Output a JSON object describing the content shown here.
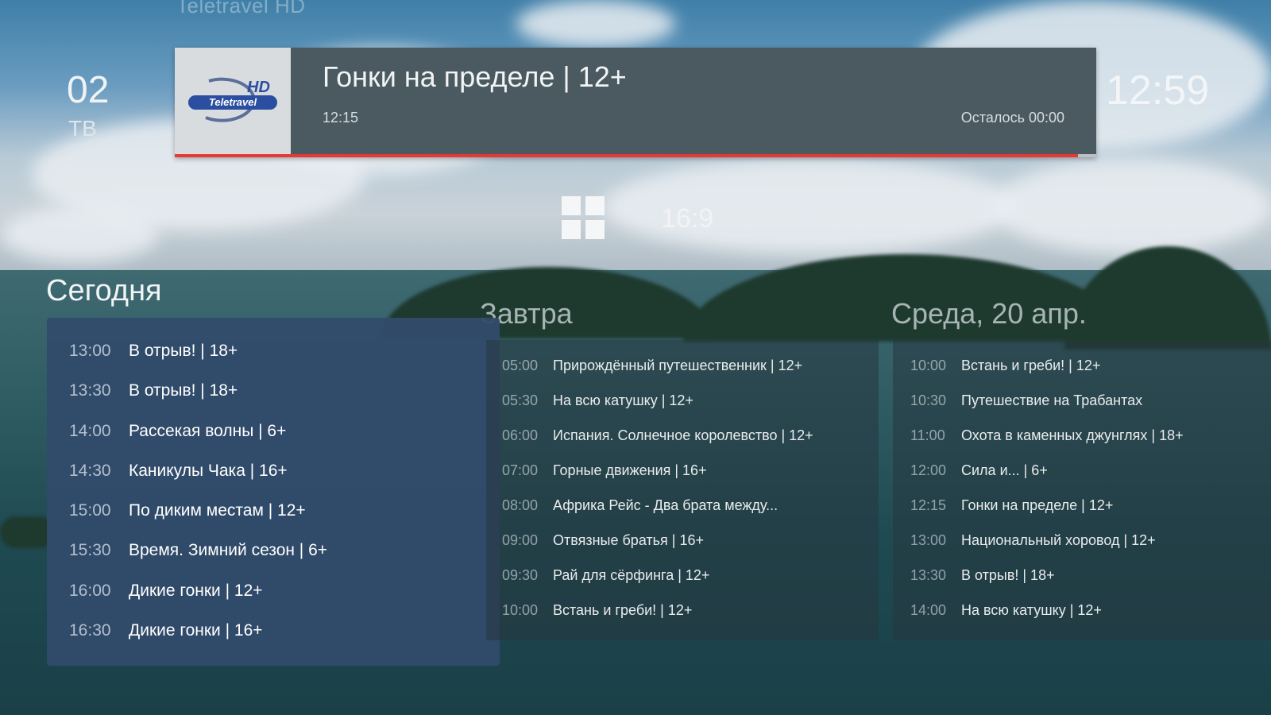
{
  "channel": {
    "faded_name": "Teletravel HD",
    "number": "02",
    "kind": "ТВ",
    "logo_text": "Teletravel",
    "logo_badge": "HD"
  },
  "clock": "12:59",
  "now_playing": {
    "title": "Гонки на пределе | 12+",
    "start": "12:15",
    "remaining": "Осталось 00:00",
    "progress": 0.98,
    "progress_color": "#e53935"
  },
  "controls": {
    "grid_icon": "grid-icon",
    "aspect": "16:9"
  },
  "schedule": {
    "today": {
      "title": "Сегодня",
      "items": [
        {
          "time": "13:00",
          "program": "В отрыв! | 18+"
        },
        {
          "time": "13:30",
          "program": "В отрыв! | 18+"
        },
        {
          "time": "14:00",
          "program": "Рассекая волны | 6+"
        },
        {
          "time": "14:30",
          "program": "Каникулы Чака | 16+"
        },
        {
          "time": "15:00",
          "program": "По диким местам | 12+"
        },
        {
          "time": "15:30",
          "program": "Время. Зимний сезон | 6+"
        },
        {
          "time": "16:00",
          "program": "Дикие гонки | 12+"
        },
        {
          "time": "16:30",
          "program": "Дикие гонки | 16+"
        }
      ]
    },
    "tomorrow": {
      "title": "Завтра",
      "items": [
        {
          "time": "05:00",
          "program": "Прирождённый путешественник | 12+"
        },
        {
          "time": "05:30",
          "program": "На всю катушку | 12+"
        },
        {
          "time": "06:00",
          "program": "Испания. Солнечное королевство | 12+"
        },
        {
          "time": "07:00",
          "program": "Горные движения | 16+"
        },
        {
          "time": "08:00",
          "program": "Африка Рейс - Два брата между..."
        },
        {
          "time": "09:00",
          "program": "Отвязные братья | 16+"
        },
        {
          "time": "09:30",
          "program": "Рай для сёрфинга | 12+"
        },
        {
          "time": "10:00",
          "program": "Встань и греби! | 12+"
        }
      ]
    },
    "wednesday": {
      "title": "Среда, 20 апр.",
      "items": [
        {
          "time": "10:00",
          "program": "Встань и греби! | 12+"
        },
        {
          "time": "10:30",
          "program": "Путешествие на Трабантах"
        },
        {
          "time": "11:00",
          "program": "Охота в каменных джунглях | 18+"
        },
        {
          "time": "12:00",
          "program": "Сила и... | 6+"
        },
        {
          "time": "12:15",
          "program": "Гонки на пределе | 12+"
        },
        {
          "time": "13:00",
          "program": "Национальный хоровод | 12+"
        },
        {
          "time": "13:30",
          "program": "В отрыв! | 18+"
        },
        {
          "time": "14:00",
          "program": "На всю катушку | 12+"
        }
      ]
    }
  }
}
